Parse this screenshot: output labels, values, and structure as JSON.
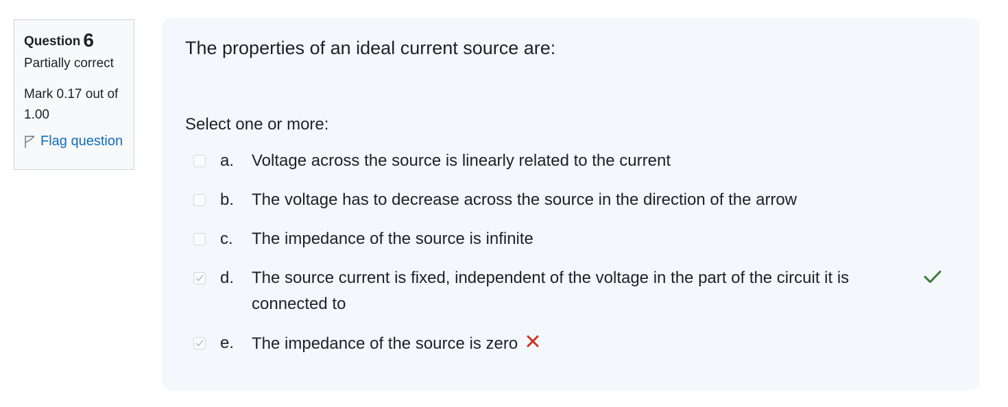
{
  "info": {
    "question_label": "Question",
    "question_number": "6",
    "state": "Partially correct",
    "grade_line1": "Mark 0.17 out of",
    "grade_line2": "1.00",
    "flag_label": "Flag question"
  },
  "question": {
    "text": "The properties of an ideal current source are:",
    "prompt": "Select one or more:",
    "options": [
      {
        "letter": "a.",
        "text": "Voltage across the source is linearly related to the current",
        "checked": false
      },
      {
        "letter": "b.",
        "text": "The voltage has to decrease across the source in the direction of the arrow",
        "checked": false
      },
      {
        "letter": "c.",
        "text": "The impedance of the source is infinite",
        "checked": false
      },
      {
        "letter": "d.",
        "text": "The source current is fixed, independent of the voltage in the part of the circuit it is connected to",
        "checked": true,
        "feedback": "correct"
      },
      {
        "letter": "e.",
        "text": "The impedance of the source is zero",
        "checked": true,
        "feedback": "incorrect"
      }
    ]
  },
  "colors": {
    "correct": "#357a32",
    "incorrect": "#ca3120",
    "link": "#0f6cbf",
    "panel_bg": "#f4f7fb"
  },
  "icons": {
    "flag": "flag-icon",
    "correct": "check-icon",
    "incorrect": "cross-icon"
  }
}
